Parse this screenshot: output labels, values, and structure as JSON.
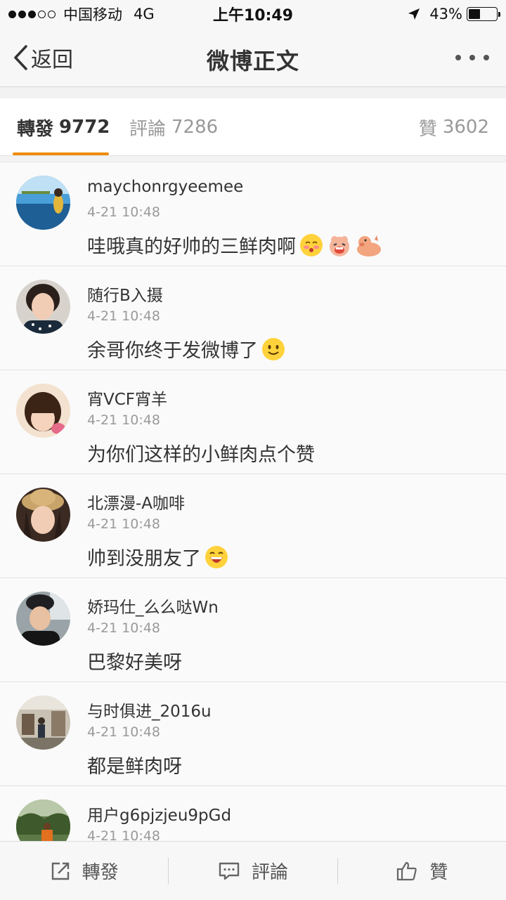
{
  "status_bar": {
    "carrier": "中国移动",
    "network": "4G",
    "time": "上午10:49",
    "battery_percent": "43%",
    "battery_level": 0.43,
    "signal_bars": 3
  },
  "nav": {
    "back_label": "返回",
    "title": "微博正文"
  },
  "tabs": {
    "reposts_label": "轉發",
    "reposts_count": "9772",
    "comments_label": "評論",
    "comments_count": "7286",
    "likes_label": "贊",
    "likes_count": "3602",
    "active": "reposts",
    "accent_color": "#f08c10"
  },
  "reposts": [
    {
      "user": "maychonrgyeemee",
      "time": "4-21 10:48",
      "text": "哇哦真的好帅的三鲜肉啊",
      "emojis": [
        "shy-face-emoji",
        "laughing-pig-emoji",
        "pig-emoji"
      ]
    },
    {
      "user": "随行B入摄",
      "time": "4-21 10:48",
      "text": "余哥你终于发微博了",
      "emojis": [
        "smile-emoji"
      ]
    },
    {
      "user": "宵VCF宵羊",
      "time": "4-21 10:48",
      "text": "为你们这样的小鲜肉点个赞",
      "emojis": []
    },
    {
      "user": "北漂漫-A咖啡",
      "time": "4-21 10:48",
      "text": "帅到没朋友了",
      "emojis": [
        "laugh-emoji"
      ]
    },
    {
      "user": "娇玛仕_么么哒Wn",
      "time": "4-21 10:48",
      "text": "巴黎好美呀",
      "emojis": []
    },
    {
      "user": "与时俱进_2016u",
      "time": "4-21 10:48",
      "text": "都是鲜肉呀",
      "emojis": []
    },
    {
      "user": "用户g6pjzjeu9pGd",
      "time": "4-21 10:48",
      "text": "",
      "emojis": []
    }
  ],
  "toolbar": {
    "repost_label": "轉發",
    "comment_label": "評論",
    "like_label": "贊"
  }
}
